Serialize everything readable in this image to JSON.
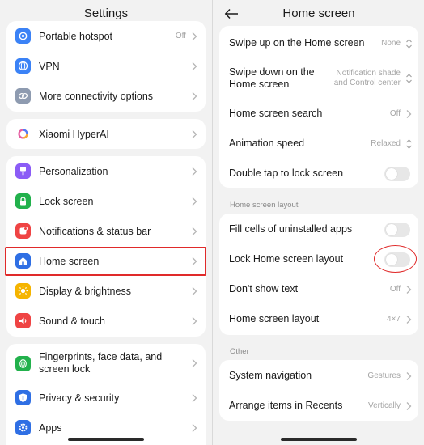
{
  "left": {
    "title": "Settings",
    "groups": [
      {
        "items": [
          {
            "label": "Portable hotspot",
            "value": "Off",
            "icon": "hotspot-icon",
            "color": "#3b82f6"
          },
          {
            "label": "VPN",
            "value": "",
            "icon": "globe-icon",
            "color": "#3b82f6"
          },
          {
            "label": "More connectivity options",
            "value": "",
            "icon": "link-icon",
            "color": "#8e9bb0"
          }
        ]
      },
      {
        "items": [
          {
            "label": "Xiaomi HyperAI",
            "value": "",
            "icon": "hyperai-icon",
            "color": "#ffffff"
          }
        ]
      },
      {
        "items": [
          {
            "label": "Personalization",
            "value": "",
            "icon": "brush-icon",
            "color": "#8b5cf6"
          },
          {
            "label": "Lock screen",
            "value": "",
            "icon": "lock-icon",
            "color": "#22b14c"
          },
          {
            "label": "Notifications & status bar",
            "value": "",
            "icon": "bell-icon",
            "color": "#ef4444"
          },
          {
            "label": "Home screen",
            "value": "",
            "icon": "home-icon",
            "color": "#2f6fe4"
          },
          {
            "label": "Display & brightness",
            "value": "",
            "icon": "sun-icon",
            "color": "#f5b400"
          },
          {
            "label": "Sound & touch",
            "value": "",
            "icon": "speaker-icon",
            "color": "#ef4444"
          }
        ]
      },
      {
        "items": [
          {
            "label": "Fingerprints, face data, and screen lock",
            "value": "",
            "icon": "fingerprint-icon",
            "color": "#22b14c"
          },
          {
            "label": "Privacy & security",
            "value": "",
            "icon": "shield-icon",
            "color": "#2f6fe4"
          },
          {
            "label": "Apps",
            "value": "",
            "icon": "gear-icon",
            "color": "#2f6fe4"
          }
        ]
      }
    ]
  },
  "right": {
    "title": "Home screen",
    "group1": [
      {
        "label": "Swipe up on the Home screen",
        "value": "None",
        "control": "updown"
      },
      {
        "label": "Swipe down on the Home screen",
        "value": "Notification shade and Control center",
        "control": "updown"
      },
      {
        "label": "Home screen search",
        "value": "Off",
        "control": "chevron"
      },
      {
        "label": "Animation speed",
        "value": "Relaxed",
        "control": "updown"
      },
      {
        "label": "Double tap to lock screen",
        "value": "",
        "control": "toggle",
        "state": "off"
      }
    ],
    "section2": "Home screen layout",
    "group2": [
      {
        "label": "Fill cells of uninstalled apps",
        "value": "",
        "control": "toggle",
        "state": "off"
      },
      {
        "label": "Lock Home screen layout",
        "value": "",
        "control": "toggle",
        "state": "off"
      },
      {
        "label": "Don't show text",
        "value": "Off",
        "control": "chevron"
      },
      {
        "label": "Home screen layout",
        "value": "4×7",
        "control": "chevron"
      }
    ],
    "section3": "Other",
    "group3": [
      {
        "label": "System navigation",
        "value": "Gestures",
        "control": "chevron"
      },
      {
        "label": "Arrange items in Recents",
        "value": "Vertically",
        "control": "chevron"
      }
    ]
  },
  "colors": {
    "highlight": "#e02a2a",
    "toggle_off": "#e7e7e7",
    "secondary_text": "#a5a5a5"
  }
}
